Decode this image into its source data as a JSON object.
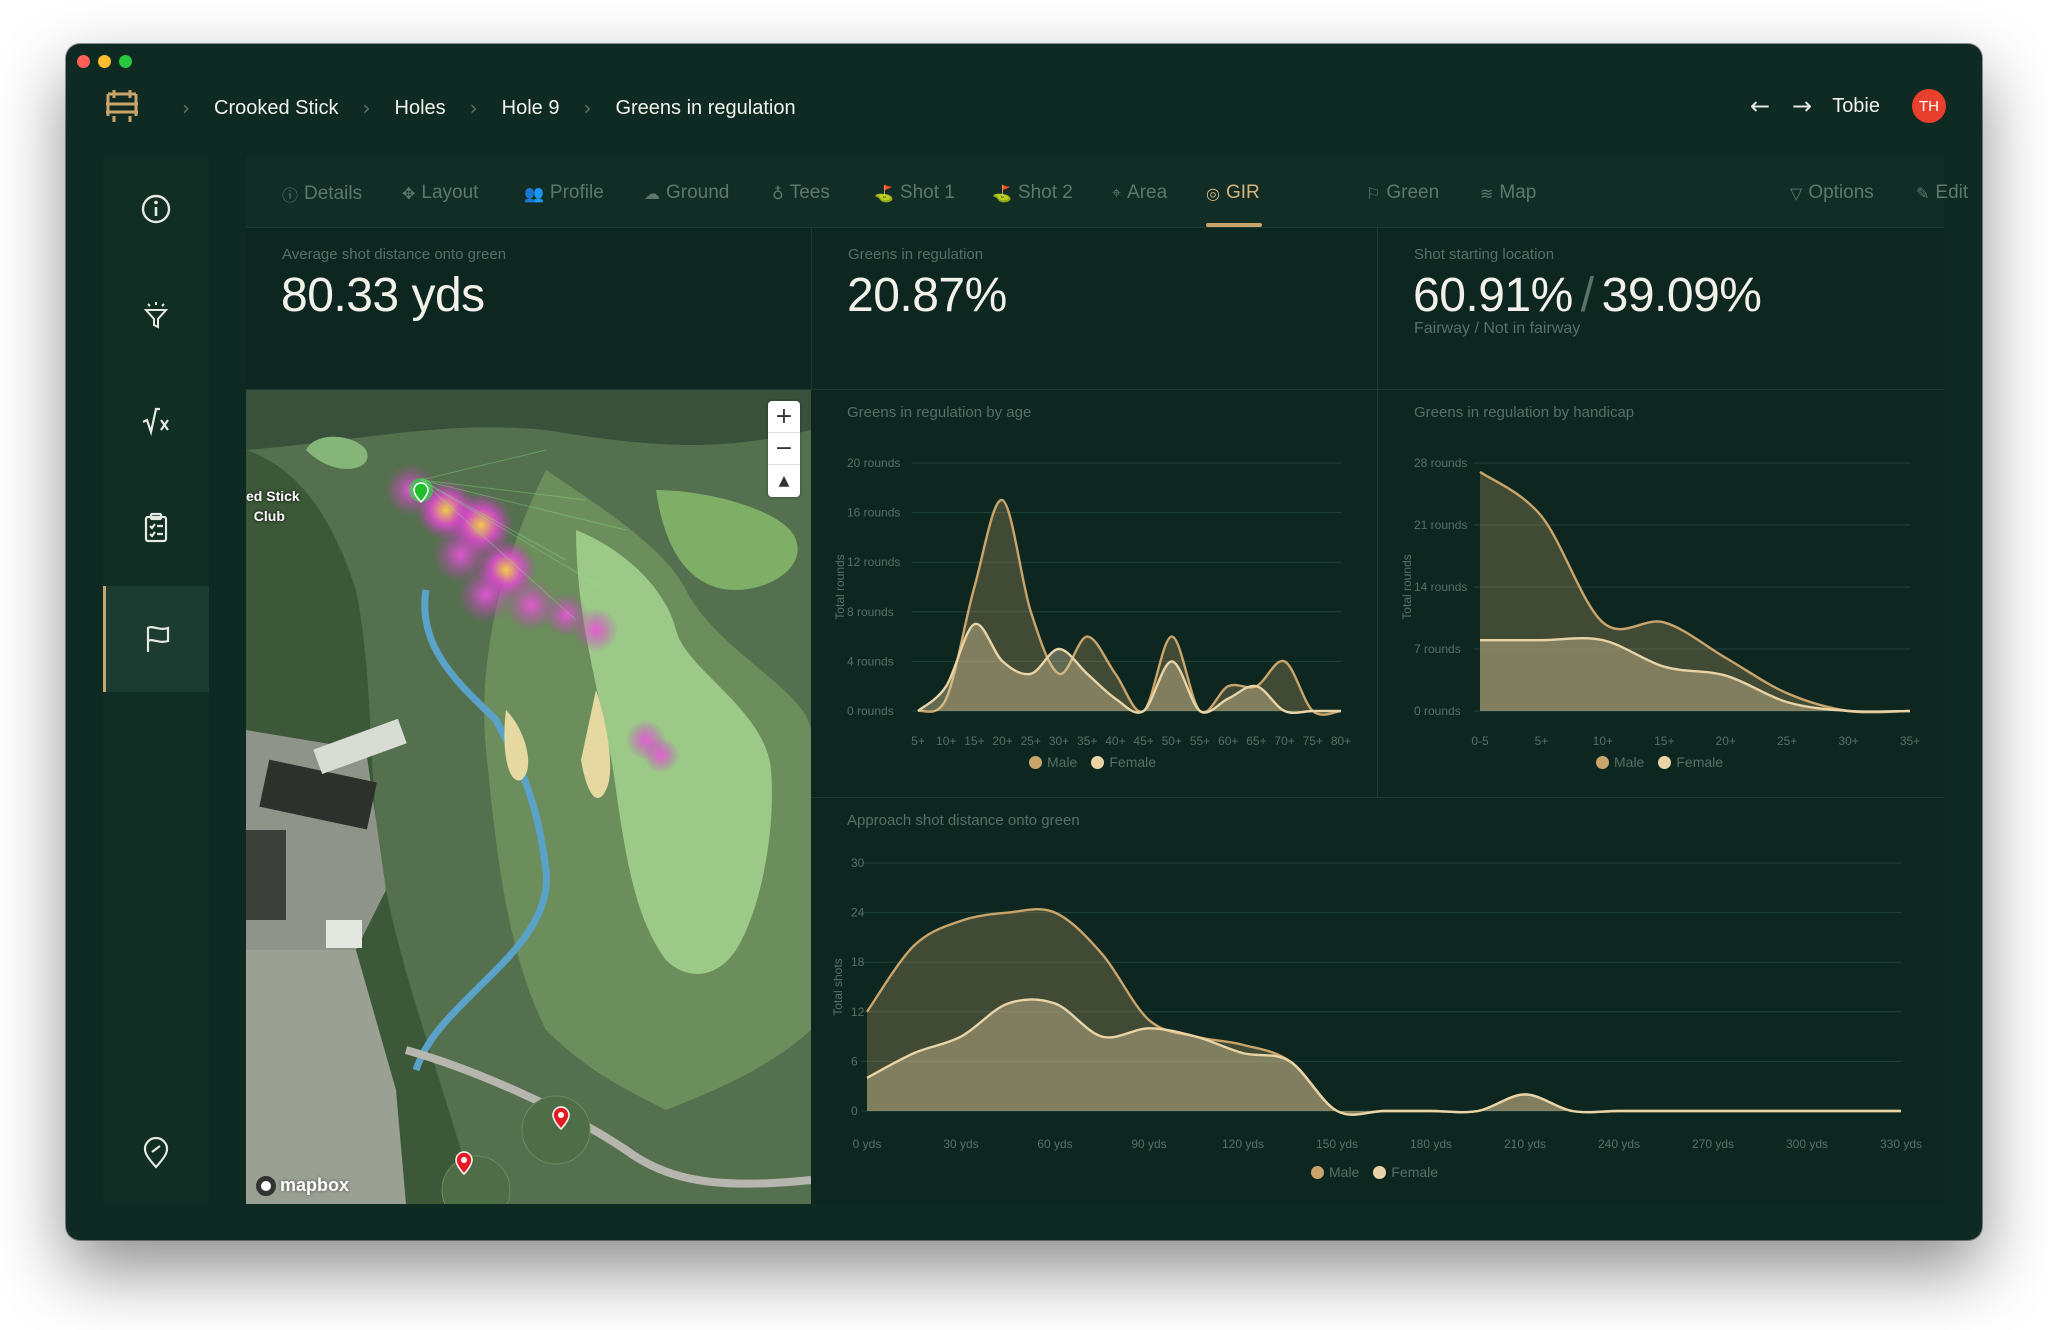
{
  "breadcrumb": [
    "Crooked Stick",
    "Holes",
    "Hole 9",
    "Greens in regulation"
  ],
  "user": {
    "name": "Tobie",
    "initials": "TH"
  },
  "colors": {
    "male": "#c9a56b",
    "female": "#e8d4a6",
    "accent": "#c9a56b",
    "bg": "#0f2a22"
  },
  "sidebar": [
    {
      "name": "info-icon",
      "active": false
    },
    {
      "name": "filter-icon",
      "active": false
    },
    {
      "name": "formula-icon",
      "active": false
    },
    {
      "name": "clipboard-icon",
      "active": false
    },
    {
      "name": "flag-icon",
      "active": true
    },
    {
      "name": "location-icon",
      "active": false
    }
  ],
  "tabs": [
    {
      "label": "Details",
      "icon": "ⓘ"
    },
    {
      "label": "Layout",
      "icon": "✥"
    },
    {
      "label": "Profile",
      "icon": "👥"
    },
    {
      "label": "Ground",
      "icon": "☁"
    },
    {
      "label": "Tees",
      "icon": "♁"
    },
    {
      "label": "Shot 1",
      "icon": "⛳"
    },
    {
      "label": "Shot 2",
      "icon": "⛳"
    },
    {
      "label": "Area",
      "icon": "⌖"
    },
    {
      "label": "GIR",
      "icon": "◎",
      "active": true
    },
    {
      "label": "Green",
      "icon": "⚐"
    },
    {
      "label": "Map",
      "icon": "≋"
    }
  ],
  "tab_actions": [
    {
      "label": "Options",
      "icon": "⏚"
    },
    {
      "label": "Edit",
      "icon": "✎"
    }
  ],
  "stats": {
    "avg_distance": {
      "label": "Average shot distance onto green",
      "value": "80.33 yds"
    },
    "gir": {
      "label": "Greens in regulation",
      "value": "20.87%"
    },
    "start_location": {
      "label": "Shot starting location",
      "value_a": "60.91%",
      "sep": "/",
      "value_b": "39.09%",
      "sub": "Fairway / Not in fairway"
    }
  },
  "map": {
    "zoom_in": "+",
    "zoom_out": "−",
    "compass": "▲",
    "attribution": "mapbox",
    "club_label_line1": "ed Stick",
    "club_label_line2": "Club"
  },
  "legend": {
    "male": "Male",
    "female": "Female"
  },
  "chart_data": [
    {
      "type": "area",
      "title": "Greens in regulation by age",
      "ylabel": "Total rounds",
      "y_ticks": [
        "0 rounds",
        "4 rounds",
        "8 rounds",
        "12 rounds",
        "16 rounds",
        "20 rounds"
      ],
      "ylim": [
        0,
        20
      ],
      "categories": [
        "5+",
        "10+",
        "15+",
        "20+",
        "25+",
        "30+",
        "35+",
        "40+",
        "45+",
        "50+",
        "55+",
        "60+",
        "65+",
        "70+",
        "75+",
        "80+"
      ],
      "series": [
        {
          "name": "Male",
          "values": [
            0,
            1,
            10,
            17,
            8,
            3,
            6,
            3,
            0,
            6,
            0,
            2,
            2,
            4,
            0,
            0
          ]
        },
        {
          "name": "Female",
          "values": [
            0,
            2,
            7,
            4,
            3,
            5,
            3,
            1,
            0,
            4,
            0,
            1,
            2,
            0,
            0,
            0
          ]
        }
      ]
    },
    {
      "type": "area",
      "title": "Greens in regulation by handicap",
      "ylabel": "Total rounds",
      "y_ticks": [
        "0 rounds",
        "7 rounds",
        "14 rounds",
        "21 rounds",
        "28 rounds"
      ],
      "ylim": [
        0,
        28
      ],
      "categories": [
        "0-5",
        "5+",
        "10+",
        "15+",
        "20+",
        "25+",
        "30+",
        "35+"
      ],
      "series": [
        {
          "name": "Male",
          "values": [
            27,
            22,
            10,
            10,
            6,
            2,
            0,
            0
          ]
        },
        {
          "name": "Female",
          "values": [
            8,
            8,
            8,
            5,
            4,
            1,
            0,
            0
          ]
        }
      ]
    },
    {
      "type": "area",
      "title": "Approach shot distance onto green",
      "ylabel": "Total shots",
      "y_ticks": [
        "0",
        "6",
        "12",
        "18",
        "24",
        "30"
      ],
      "ylim": [
        0,
        30
      ],
      "x_labels": [
        "0 yds",
        "30 yds",
        "60 yds",
        "90 yds",
        "120 yds",
        "150 yds",
        "180 yds",
        "210 yds",
        "240 yds",
        "270 yds",
        "300 yds",
        "330 yds"
      ],
      "x": [
        0,
        15,
        30,
        45,
        60,
        75,
        90,
        105,
        120,
        135,
        150,
        165,
        180,
        195,
        210,
        225,
        240,
        255,
        270,
        285,
        300,
        315,
        330
      ],
      "series": [
        {
          "name": "Male",
          "values": [
            12,
            20,
            23,
            24,
            24,
            19,
            11,
            9,
            8,
            6,
            0,
            0,
            0,
            0,
            2,
            0,
            0,
            0,
            0,
            0,
            0,
            0,
            0
          ]
        },
        {
          "name": "Female",
          "values": [
            4,
            7,
            9,
            13,
            13,
            9,
            10,
            9,
            7,
            6,
            0,
            0,
            0,
            0,
            2,
            0,
            0,
            0,
            0,
            0,
            0,
            0,
            0
          ]
        }
      ]
    }
  ]
}
